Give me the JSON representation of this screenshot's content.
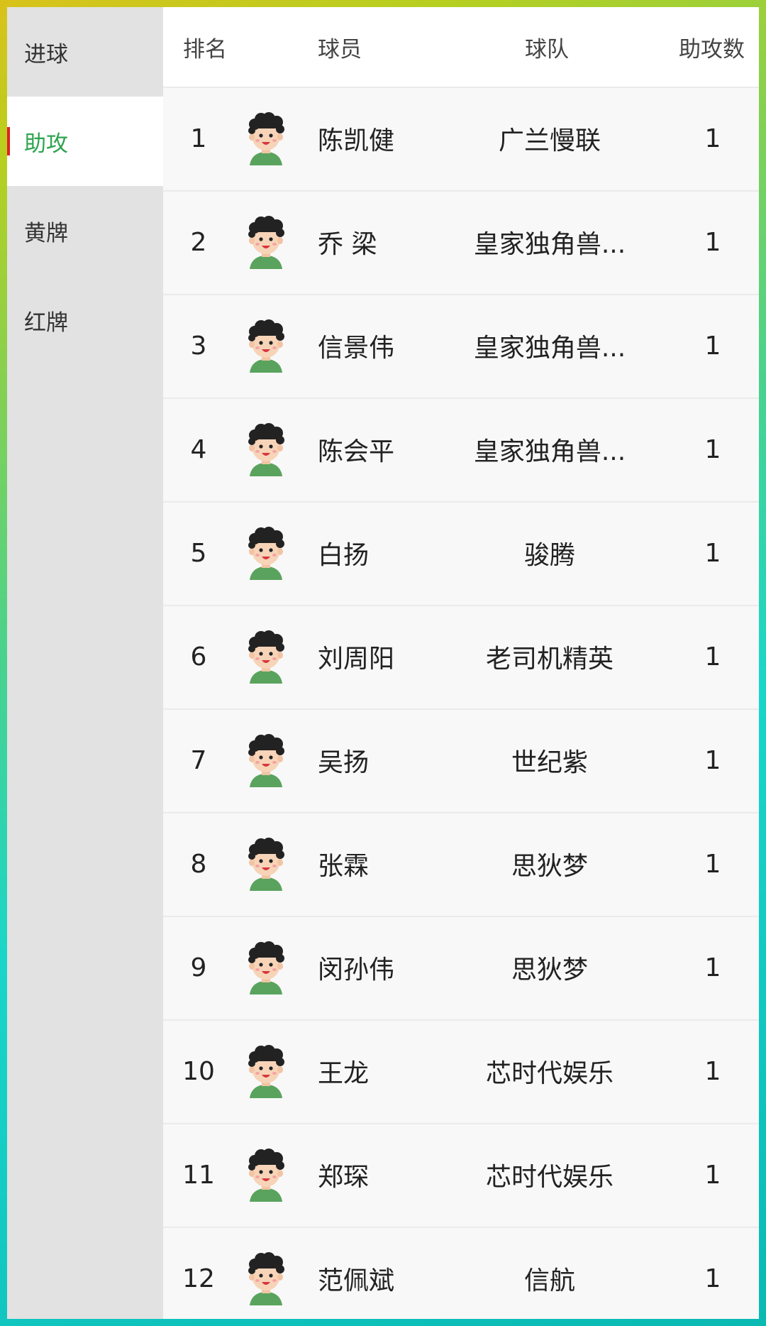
{
  "sidebar": {
    "items": [
      {
        "label": "进球",
        "active": false
      },
      {
        "label": "助攻",
        "active": true
      },
      {
        "label": "黄牌",
        "active": false
      },
      {
        "label": "红牌",
        "active": false
      }
    ]
  },
  "table": {
    "headers": {
      "rank": "排名",
      "player": "球员",
      "team": "球队",
      "assists": "助攻数"
    },
    "avatar_icon": "cartoon-player-avatar-icon",
    "rows": [
      {
        "rank": "1",
        "player": "陈凯健",
        "team": "广兰慢联",
        "assists": "1"
      },
      {
        "rank": "2",
        "player": "乔 梁",
        "team": "皇家独角兽...",
        "assists": "1"
      },
      {
        "rank": "3",
        "player": "信景伟",
        "team": "皇家独角兽...",
        "assists": "1"
      },
      {
        "rank": "4",
        "player": "陈会平",
        "team": "皇家独角兽...",
        "assists": "1"
      },
      {
        "rank": "5",
        "player": "白扬",
        "team": "骏腾",
        "assists": "1"
      },
      {
        "rank": "6",
        "player": "刘周阳",
        "team": "老司机精英",
        "assists": "1"
      },
      {
        "rank": "7",
        "player": "吴扬",
        "team": "世纪紫",
        "assists": "1"
      },
      {
        "rank": "8",
        "player": "张霖",
        "team": "思狄梦",
        "assists": "1"
      },
      {
        "rank": "9",
        "player": "闵孙伟",
        "team": "思狄梦",
        "assists": "1"
      },
      {
        "rank": "10",
        "player": "王龙",
        "team": "芯时代娱乐",
        "assists": "1"
      },
      {
        "rank": "11",
        "player": "郑琛",
        "team": "芯时代娱乐",
        "assists": "1"
      },
      {
        "rank": "12",
        "player": "范佩斌",
        "team": "信航",
        "assists": "1"
      }
    ]
  },
  "colors": {
    "active_tab": "#2ea44f",
    "active_indicator": "#e02020",
    "sidebar_bg": "#e2e2e2",
    "avatar_hair": "#222222",
    "avatar_shirt": "#5aa35e",
    "avatar_skin": "#f7d4b8"
  }
}
